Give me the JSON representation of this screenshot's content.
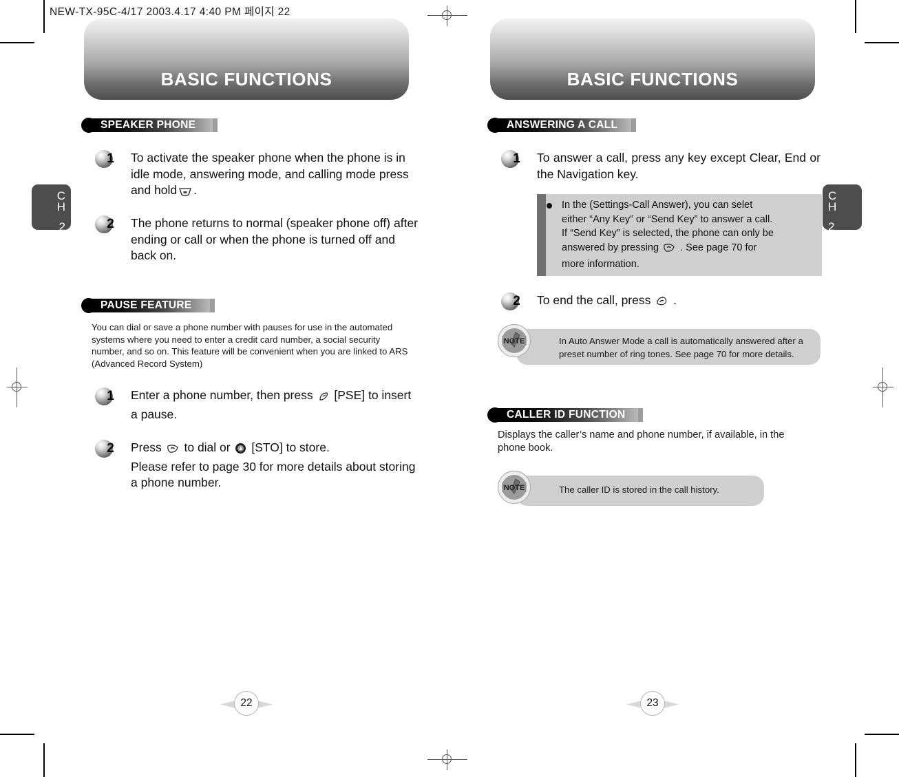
{
  "slug": "NEW-TX-95C-4/17  2003.4.17 4:40 PM  페이지 22",
  "banner_title": "BASIC FUNCTIONS",
  "chapter_tab": {
    "c": "C",
    "h": "H",
    "number": "2"
  },
  "left_page": {
    "page_number": "22",
    "sections": [
      {
        "title": "SPEAKER PHONE",
        "steps": [
          {
            "number": "1",
            "text": "To activate the speaker phone  when the phone is in idle mode, answering mode, and calling mode press and hold"
          },
          {
            "number": "2",
            "text": "The phone returns to normal (speaker phone off) after ending or call or when the phone is turned off and back on."
          }
        ]
      },
      {
        "title": "PAUSE FEATURE",
        "intro": "You can dial or save a phone number with pauses for use in the automated systems where you need to enter a credit card number, a social security number, and so on. This feature will be convenient when you are linked to ARS (Advanced Record System)",
        "steps": [
          {
            "number": "1",
            "text_before": "Enter a phone number, then press",
            "text_after": "[PSE] to insert a pause."
          },
          {
            "number": "2",
            "text_before": "Press",
            "text_mid": "to dial or",
            "text_after": "[STO] to store.",
            "text_line2": "Please refer to page 30 for more details about storing a phone number."
          }
        ]
      }
    ]
  },
  "right_page": {
    "page_number": "23",
    "sections": [
      {
        "title": "ANSWERING A CALL",
        "steps": [
          {
            "number": "1",
            "text": "To answer a call, press any key except Clear, End or the Navigation key."
          },
          {
            "number": "2",
            "text_before": "To end the call, press",
            "text_after": "."
          }
        ],
        "callout": {
          "line1": "In the (Settings-Call Answer), you can selet",
          "line2": "either “Any Key” or “Send Key” to answer a call.",
          "line3": "If “Send Key” is selected, the phone can only be",
          "line4_before": "answered by pressing",
          "line4_after": ". See page 70 for",
          "line5": "more information."
        },
        "note": "In Auto Answer Mode a call is automatically answered after a preset number of ring tones. See page 70 for more details."
      },
      {
        "title": "CALLER ID FUNCTION",
        "intro": "Displays the caller’s name and phone number, if available, in the phone book.",
        "note": "The caller ID is stored in the call history."
      }
    ]
  },
  "icons": {
    "speaker_key": "speaker-key-icon",
    "pause_key": "pause-key-icon",
    "send_key": "send-key-icon",
    "store_key": "store-key-icon",
    "end_key": "end-key-icon",
    "note_badge": "note-badge-icon"
  },
  "colors": {
    "banner_top": "#f2f2f2",
    "banner_bottom": "#4e4e4e",
    "tab_bg": "#4d4d4d",
    "callout_bg": "#cfcfcf",
    "callout_bar": "#707070"
  }
}
